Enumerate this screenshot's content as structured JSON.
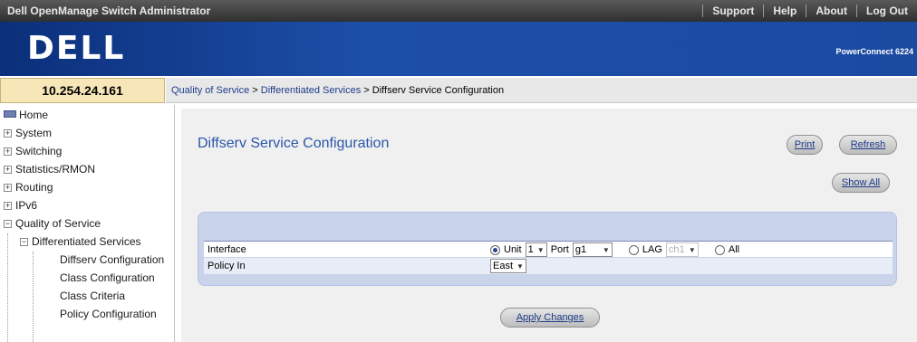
{
  "topbar": {
    "title": "Dell OpenManage Switch Administrator",
    "links": [
      "Support",
      "Help",
      "About",
      "Log Out"
    ]
  },
  "brand": {
    "logo": "DELL",
    "product": "PowerConnect 6224"
  },
  "address": {
    "ip": "10.254.24.161",
    "breadcrumb": [
      "Quality of Service",
      "Differentiated Services",
      "Diffserv Service Configuration"
    ],
    "separator": ">"
  },
  "nav": {
    "items": [
      {
        "label": "Home",
        "level": 0,
        "icon": "home-icon"
      },
      {
        "label": "System",
        "level": 0,
        "expander": "+"
      },
      {
        "label": "Switching",
        "level": 0,
        "expander": "+"
      },
      {
        "label": "Statistics/RMON",
        "level": 0,
        "expander": "+"
      },
      {
        "label": "Routing",
        "level": 0,
        "expander": "+"
      },
      {
        "label": "IPv6",
        "level": 0,
        "expander": "+"
      },
      {
        "label": "Quality of Service",
        "level": 0,
        "expander": "−"
      },
      {
        "label": "Differentiated Services",
        "level": 1,
        "expander": "−"
      },
      {
        "label": "Diffserv Configuration",
        "level": 2
      },
      {
        "label": "Class Configuration",
        "level": 2
      },
      {
        "label": "Class Criteria",
        "level": 2
      },
      {
        "label": "Policy Configuration",
        "level": 2
      }
    ]
  },
  "main": {
    "heading": "Diffserv Service Configuration",
    "buttons": {
      "print": "Print",
      "refresh": "Refresh",
      "show_all": "Show All",
      "apply": "Apply Changes"
    },
    "form": {
      "interface_label": "Interface",
      "unit_label": "Unit",
      "unit_value": "1",
      "port_label": "Port",
      "port_value": "g1",
      "lag_label": "LAG",
      "lag_value": "ch1",
      "all_label": "All",
      "policy_label": "Policy In",
      "policy_value": "East"
    }
  },
  "colors": {
    "brand_blue": "#1c4fa8",
    "heading_blue": "#2a56a8",
    "ip_cell": "#f7e6b8",
    "form_box": "#c9d3ea"
  }
}
